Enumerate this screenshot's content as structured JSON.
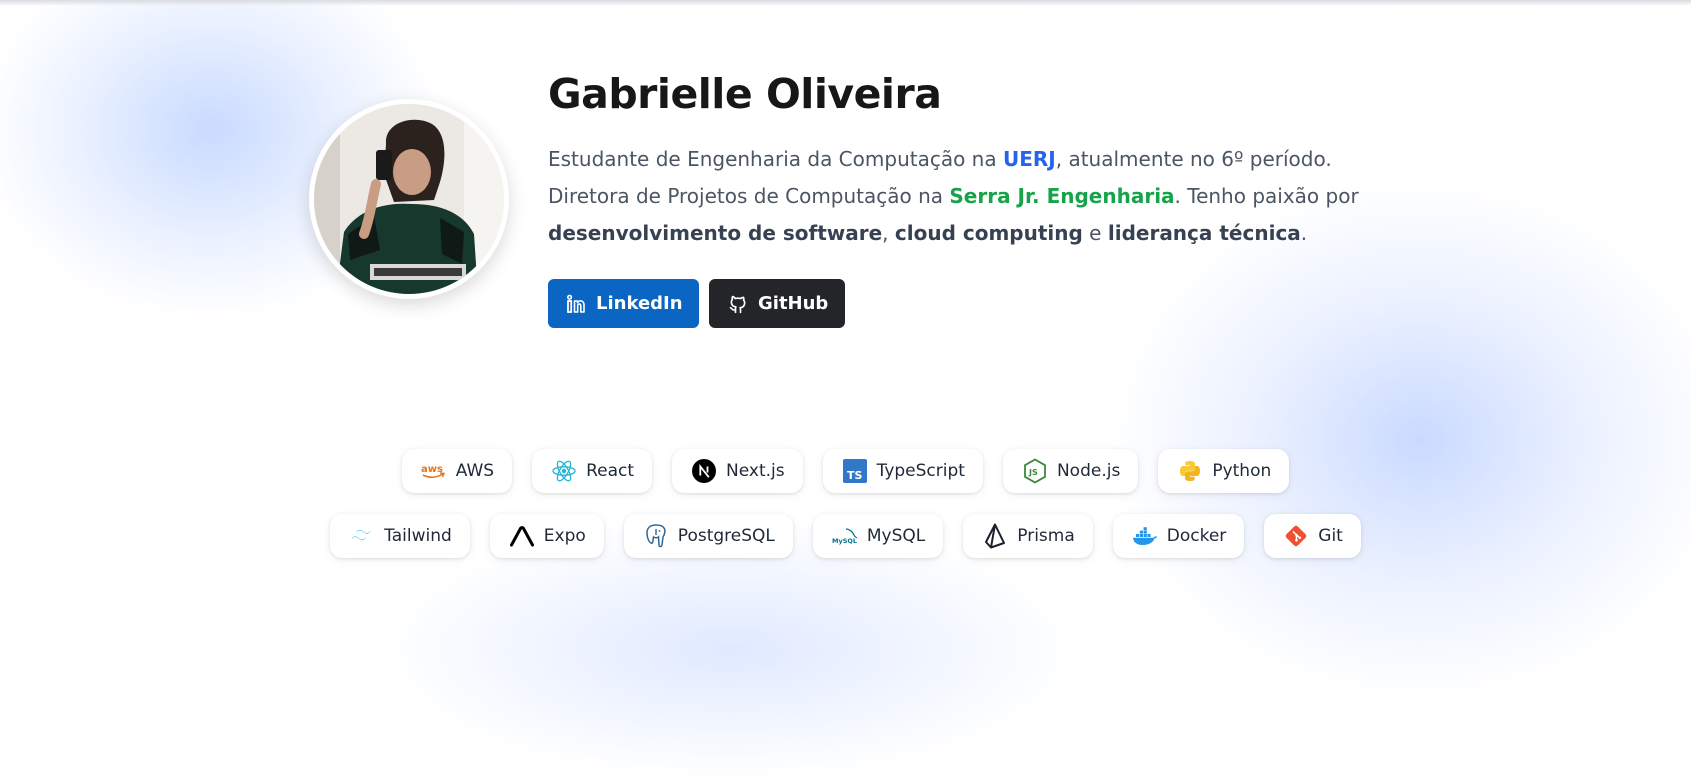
{
  "profile": {
    "name": "Gabrielle Oliveira",
    "bio": {
      "p1": "Estudante de Engenharia da Computação na ",
      "university": "UERJ",
      "p2": ", atualmente no 6º período. Diretora de Projetos de Computação na ",
      "org": "Serra Jr. Engenharia",
      "p3": ". Tenho paixão por ",
      "skill1": "desenvolvimento de software",
      "p4": ", ",
      "skill2": "cloud computing",
      "p5": " e ",
      "skill3": "liderança técnica",
      "p6": "."
    },
    "avatar_icon": "profile-photo"
  },
  "buttons": {
    "linkedin": {
      "label": "LinkedIn",
      "icon": "linkedin-icon",
      "color": "#0a66c2"
    },
    "github": {
      "label": "GitHub",
      "icon": "github-icon",
      "color": "#242529"
    }
  },
  "technologies": {
    "row1": [
      {
        "label": "AWS",
        "icon": "aws-icon"
      },
      {
        "label": "React",
        "icon": "react-icon"
      },
      {
        "label": "Next.js",
        "icon": "nextjs-icon"
      },
      {
        "label": "TypeScript",
        "icon": "typescript-icon"
      },
      {
        "label": "Node.js",
        "icon": "nodejs-icon"
      },
      {
        "label": "Python",
        "icon": "python-icon"
      }
    ],
    "row2": [
      {
        "label": "Tailwind",
        "icon": "tailwind-icon"
      },
      {
        "label": "Expo",
        "icon": "expo-icon"
      },
      {
        "label": "PostgreSQL",
        "icon": "postgresql-icon"
      },
      {
        "label": "MySQL",
        "icon": "mysql-icon"
      },
      {
        "label": "Prisma",
        "icon": "prisma-icon"
      },
      {
        "label": "Docker",
        "icon": "docker-icon"
      },
      {
        "label": "Git",
        "icon": "git-icon"
      }
    ]
  },
  "colors": {
    "university_link": "#2563eb",
    "org_link": "#16a34a",
    "text": "#4b5563"
  }
}
